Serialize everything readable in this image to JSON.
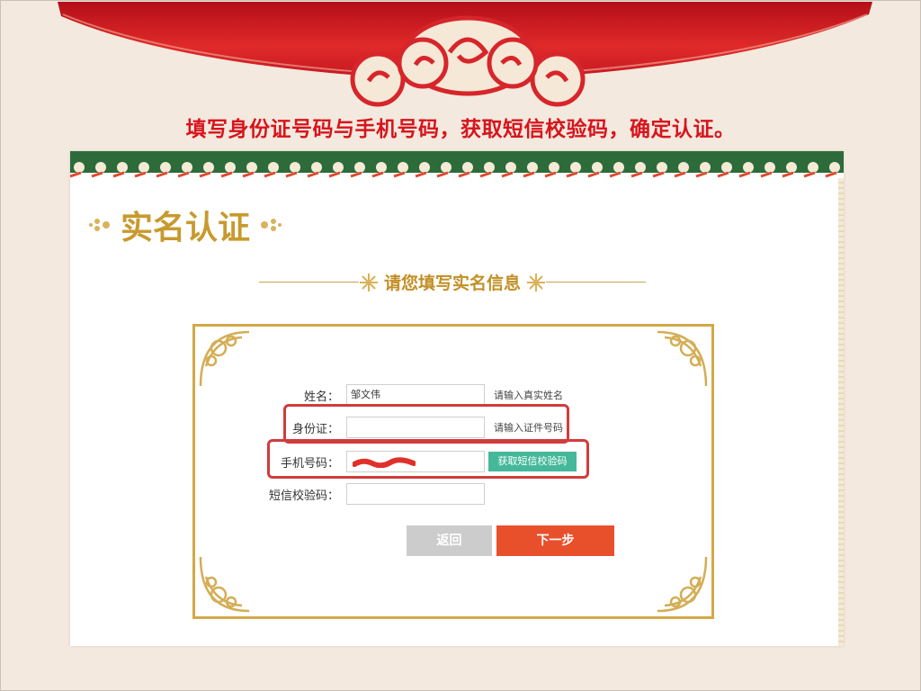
{
  "instruction": "填写身份证号码与手机号码，获取短信校验码，确定认证。",
  "page": {
    "title": "实名认证",
    "subtitle": "请您填写实名信息"
  },
  "form": {
    "name": {
      "label": "姓名：",
      "value": "邹文伟",
      "hint": "请输入真实姓名"
    },
    "id_card": {
      "label": "身份证：",
      "value": "",
      "hint": "请输入证件号码"
    },
    "phone": {
      "label": "手机号码：",
      "value": "",
      "sms_button": "获取短信校验码"
    },
    "sms_code": {
      "label": "短信校验码：",
      "value": ""
    }
  },
  "buttons": {
    "back": "返回",
    "next": "下一步"
  },
  "colors": {
    "accent_red": "#d8141c",
    "gold": "#c79a2e",
    "sms_button": "#45b89a",
    "next_button": "#e8502c",
    "back_button": "#cccccc",
    "highlight": "#d13c3c"
  }
}
